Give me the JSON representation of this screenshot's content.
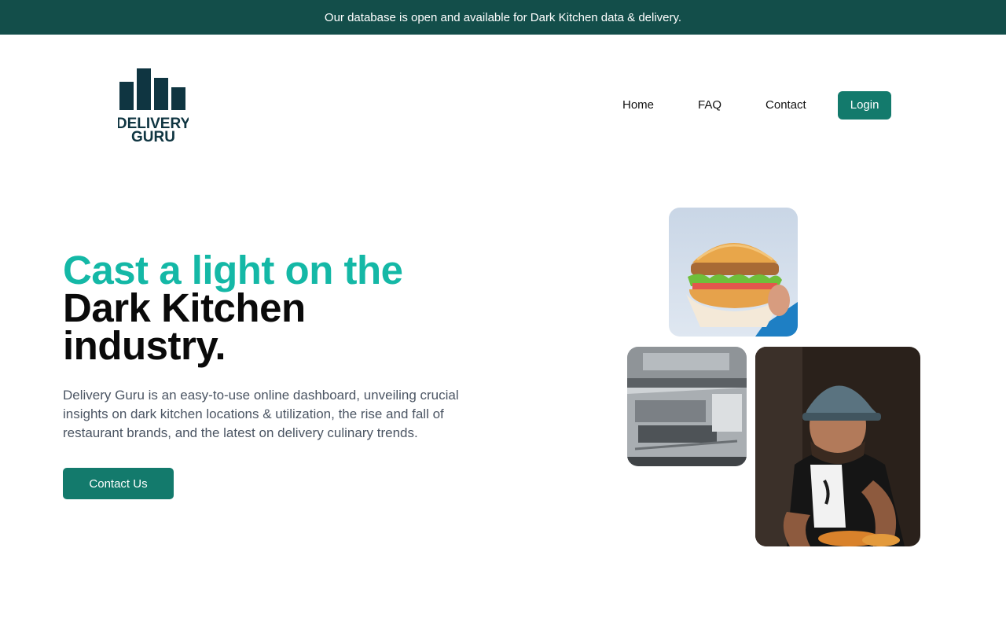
{
  "banner": {
    "text": "Our database is open and available for Dark Kitchen data & delivery."
  },
  "logo": {
    "line1": "DELIVERY",
    "line2": "GURU",
    "color": "#0f3541"
  },
  "nav": {
    "items": [
      {
        "label": "Home"
      },
      {
        "label": "FAQ"
      },
      {
        "label": "Contact"
      }
    ],
    "login_label": "Login"
  },
  "hero": {
    "title_accent": "Cast a light on the",
    "title_line2": "Dark Kitchen",
    "title_line3": "industry.",
    "description": "Delivery Guru is an easy-to-use online dashboard, unveiling crucial insights on dark kitchen locations & utilization, the rise and fall of restaurant brands, and the latest on delivery culinary trends.",
    "cta_label": "Contact Us"
  },
  "colors": {
    "banner": "#134e4a",
    "accent": "#14b8a6",
    "button": "#137a6c"
  },
  "images": [
    {
      "name": "burger-photo"
    },
    {
      "name": "kitchen-photo"
    },
    {
      "name": "chef-photo"
    }
  ]
}
